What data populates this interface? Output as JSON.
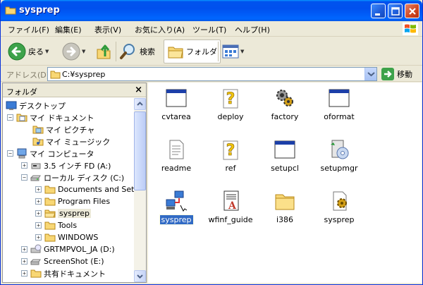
{
  "window": {
    "title": "sysprep"
  },
  "menu": [
    "ファイル(F)",
    "編集(E)",
    "表示(V)",
    "お気に入り(A)",
    "ツール(T)",
    "ヘルプ(H)"
  ],
  "toolbar": {
    "back": "戻る",
    "search": "検索",
    "folders": "フォルダ"
  },
  "address": {
    "label": "アドレス(D)",
    "value": "C:¥sysprep",
    "go": "移動"
  },
  "folders_pane": {
    "title": "フォルダ",
    "close": "×",
    "tree": [
      {
        "label": "デスクトップ",
        "expander": "",
        "icon": "desktop-icon"
      },
      {
        "label": "マイ ドキュメント",
        "expander": "−",
        "icon": "my-documents-icon"
      },
      {
        "label": "マイ ピクチャ",
        "expander": "",
        "icon": "my-pictures-icon"
      },
      {
        "label": "マイ ミュージック",
        "expander": "",
        "icon": "my-music-icon"
      },
      {
        "label": "マイ コンピュータ",
        "expander": "−",
        "icon": "my-computer-icon"
      },
      {
        "label": "3.5 インチ FD (A:)",
        "expander": "+",
        "icon": "floppy-icon"
      },
      {
        "label": "ローカル ディスク (C:)",
        "expander": "−",
        "icon": "hard-disk-icon"
      },
      {
        "label": "Documents and Settings",
        "expander": "+",
        "icon": "folder-icon"
      },
      {
        "label": "Program Files",
        "expander": "+",
        "icon": "folder-icon"
      },
      {
        "label": "sysprep",
        "expander": "+",
        "icon": "folder-open-icon"
      },
      {
        "label": "Tools",
        "expander": "+",
        "icon": "folder-icon"
      },
      {
        "label": "WINDOWS",
        "expander": "+",
        "icon": "folder-icon"
      },
      {
        "label": "GRTMPVOL_JA (D:)",
        "expander": "+",
        "icon": "cd-drive-icon"
      },
      {
        "label": "ScreenShot (E:)",
        "expander": "+",
        "icon": "drive-icon"
      },
      {
        "label": "共有ドキュメント",
        "expander": "+",
        "icon": "folder-icon"
      }
    ]
  },
  "files": [
    {
      "label": "cvtarea",
      "icon": "application-icon"
    },
    {
      "label": "deploy",
      "icon": "help-file-icon"
    },
    {
      "label": "factory",
      "icon": "gears-icon"
    },
    {
      "label": "oformat",
      "icon": "application-icon"
    },
    {
      "label": "readme",
      "icon": "text-file-icon"
    },
    {
      "label": "ref",
      "icon": "help-file-icon"
    },
    {
      "label": "setupcl",
      "icon": "application-icon"
    },
    {
      "label": "setupmgr",
      "icon": "setup-manager-icon"
    },
    {
      "label": "sysprep",
      "icon": "network-computers-icon",
      "selected": true
    },
    {
      "label": "wfinf_guide",
      "icon": "document-icon"
    },
    {
      "label": "i386",
      "icon": "folder-icon"
    },
    {
      "label": "sysprep",
      "icon": "settings-file-icon"
    }
  ]
}
